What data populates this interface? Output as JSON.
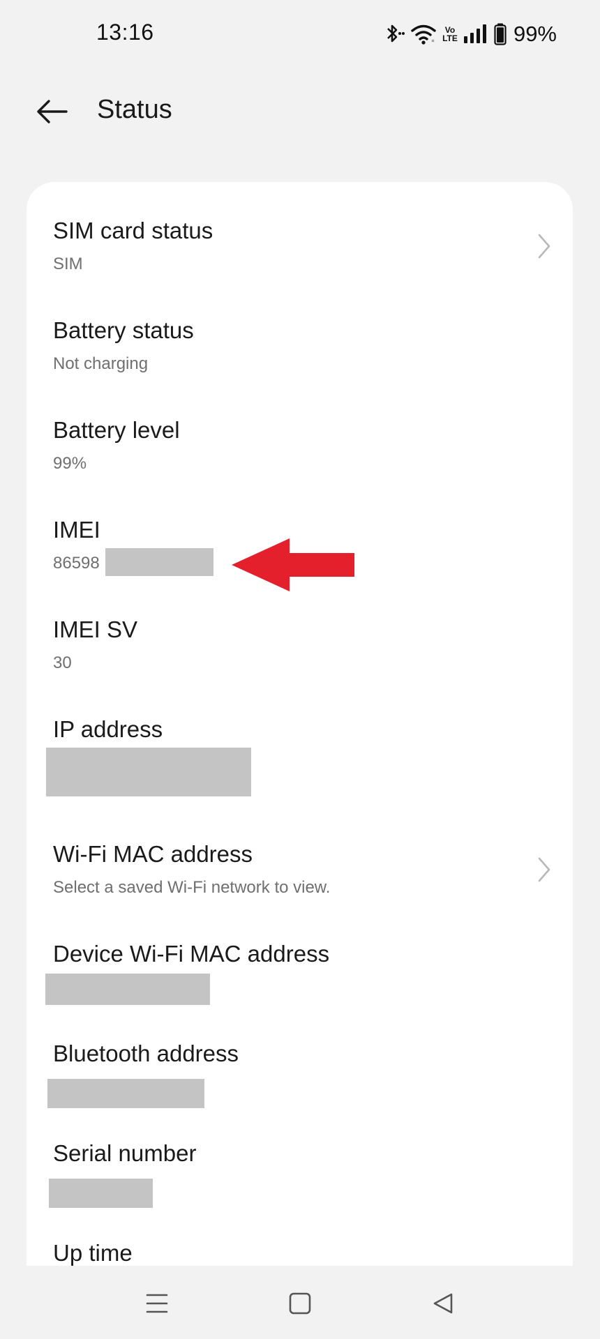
{
  "status_bar": {
    "time": "13:16",
    "battery_percent": "99%",
    "battery_level": 0.99,
    "volte_top": "Vo",
    "volte_bottom": "LTE",
    "icons": [
      "bluetooth-icon",
      "wifi-icon",
      "volte-icon",
      "signal-icon",
      "battery-icon"
    ]
  },
  "header": {
    "title": "Status",
    "back_icon": "arrow-left-icon"
  },
  "items": [
    {
      "title": "SIM card status",
      "subtitle": "SIM",
      "has_chevron": true
    },
    {
      "title": "Battery status",
      "subtitle": "Not charging"
    },
    {
      "title": "Battery level",
      "subtitle": "99%"
    },
    {
      "title": "IMEI",
      "subtitle": "86598",
      "redacted": true
    },
    {
      "title": "IMEI SV",
      "subtitle": "30"
    },
    {
      "title": "IP address",
      "redacted": true
    },
    {
      "title": "Wi-Fi MAC address",
      "subtitle": "Select a saved Wi-Fi network to view.",
      "has_chevron": true
    },
    {
      "title": "Device Wi-Fi MAC address",
      "redacted": true
    },
    {
      "title": "Bluetooth address",
      "redacted": true
    },
    {
      "title": "Serial number",
      "redacted": true
    },
    {
      "title": "Up time"
    }
  ],
  "annotation": {
    "arrow_color": "#e4202c",
    "points_to": "IMEI"
  },
  "nav_bar": {
    "icons": [
      "menu-icon",
      "home-icon",
      "back-icon"
    ]
  },
  "colors": {
    "background": "#f2f2f2",
    "card": "#ffffff",
    "redaction": "#c4c4c4",
    "subtitle": "#6f6f6f"
  }
}
